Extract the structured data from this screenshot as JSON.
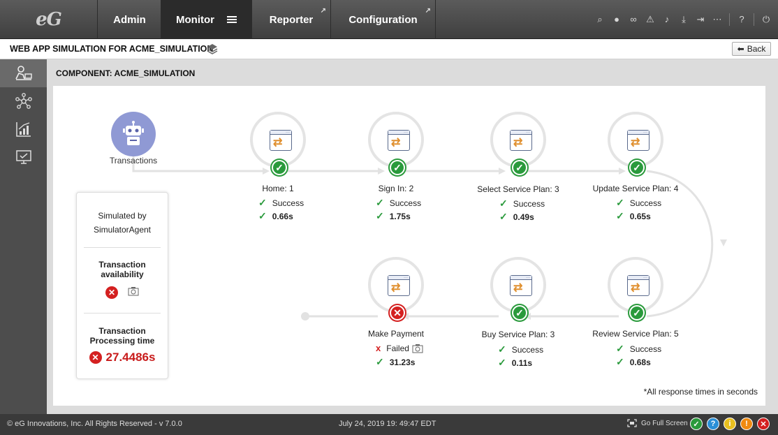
{
  "app": {
    "logo_text": "eG"
  },
  "nav": {
    "tabs": [
      {
        "label": "Admin"
      },
      {
        "label": "Monitor"
      },
      {
        "label": "Reporter"
      },
      {
        "label": "Configuration"
      }
    ],
    "top_icons": [
      "search-icon",
      "user-icon",
      "link-icon",
      "alert-icon",
      "bell-icon",
      "download-icon",
      "signout-icon",
      "more-icon",
      "help-icon",
      "power-icon"
    ]
  },
  "header": {
    "title": "WEB APP SIMULATION FOR ACME_SIMULATION",
    "back_label": "Back"
  },
  "main": {
    "component_title": "COMPONENT: ACME_SIMULATION",
    "robot_label": "Transactions",
    "summary": {
      "simulated_by_label": "Simulated by",
      "simulated_by_value": "SimulatorAgent",
      "availability_label": "Transaction availability",
      "processing_label": "Transaction Processing time",
      "processing_value": "27.4486s"
    },
    "steps": [
      {
        "name": "Home: 1",
        "status": "Success",
        "time": "0.66s"
      },
      {
        "name": "Sign In: 2",
        "status": "Success",
        "time": "1.75s"
      },
      {
        "name": "Select Service Plan: 3",
        "status": "Success",
        "time": "0.49s"
      },
      {
        "name": "Update Service Plan: 4",
        "status": "Success",
        "time": "0.65s"
      },
      {
        "name": "Review Service Plan: 5",
        "status": "Success",
        "time": "0.68s"
      },
      {
        "name": "Buy Service Plan: 3",
        "status": "Success",
        "time": "0.11s"
      },
      {
        "name": "Make Payment",
        "status": "Failed",
        "time": "31.23s"
      }
    ],
    "footnote": "*All response times in seconds"
  },
  "footer": {
    "copyright": "© eG Innovations, Inc. All Rights Reserved - v 7.0.0",
    "datetime": "July 24, 2019  19: 49:47 EDT",
    "fullscreen_label": "Go Full Screen",
    "status_colors": {
      "ok": "#2a9a3c",
      "info": "#2a8fd6",
      "warn": "#e8c020",
      "minor": "#f08a10",
      "critical": "#d42020"
    }
  }
}
